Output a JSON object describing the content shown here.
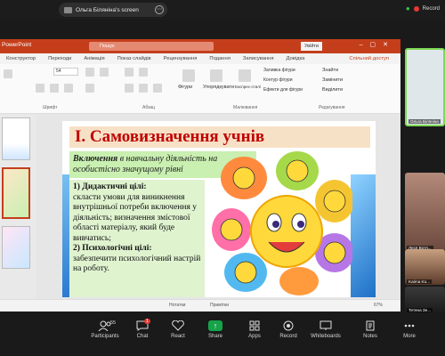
{
  "zoom_top": {
    "screen_label": "Ольга Біляніна's screen",
    "record_label": "Record"
  },
  "ppt": {
    "app_name": "PowerPoint",
    "search_placeholder": "Пошук",
    "signin_label": "Увійти",
    "tabs": [
      "Конструктор",
      "Переходи",
      "Анімація",
      "Показ слайдів",
      "Рецензування",
      "Подання",
      "Записування",
      "Довідка"
    ],
    "share_label": "Спільний доступ",
    "ribbon": {
      "font_group": "Шрифт",
      "para_group": "Абзац",
      "drawing_group": "Малювання",
      "editing_group": "Редагування",
      "shapes_label": "Фігури",
      "arrange_label": "Упорядкувати",
      "styles_label": "Експрес-стилі",
      "fill_label": "Заливка фігури",
      "outline_label": "Контур фігури",
      "effects_label": "Ефекти для фігури",
      "find_label": "Знайти",
      "replace_label": "Замінити",
      "select_label": "Виділити",
      "font_size": "54"
    },
    "slide": {
      "title": "І. Самовизначення  учнів",
      "subtitle_bold": "Включення",
      "subtitle_rest": " в навчальну діяльність на особистісно значущому рівні",
      "body": {
        "h1": "1)  Дидактичні цілі:",
        "l1": "склacти умови для виникнення внутрішньої потреби включення у діяльність; визначення змістової",
        "l2": "області матеріалу, який буде вивчатись;",
        "h2": "2) Психологічні цілі:",
        "l3": "забезпечити психологічний настрій на роботу."
      }
    },
    "status": {
      "notes_label": "Нотатки",
      "comments_label": "Примітки",
      "zoom_value": "67%"
    }
  },
  "participants": [
    {
      "name": "Ольга Біляніна"
    },
    {
      "name": "Леся Вотя..."
    },
    {
      "name": "Karina Ko..."
    },
    {
      "name": "Тетяна Зе..."
    }
  ],
  "toolbar": {
    "participants_label": "Participants",
    "participants_count": "55",
    "chat_label": "Chat",
    "chat_badge": "1",
    "react_label": "React",
    "share_label": "Share",
    "apps_label": "Apps",
    "record_label": "Record",
    "whiteboards_label": "Whiteboards",
    "notes_label": "Notes",
    "more_label": "More"
  },
  "colors": {
    "ppt_accent": "#c43e1c",
    "title_red": "#c00000",
    "share_green": "#16a34a"
  }
}
